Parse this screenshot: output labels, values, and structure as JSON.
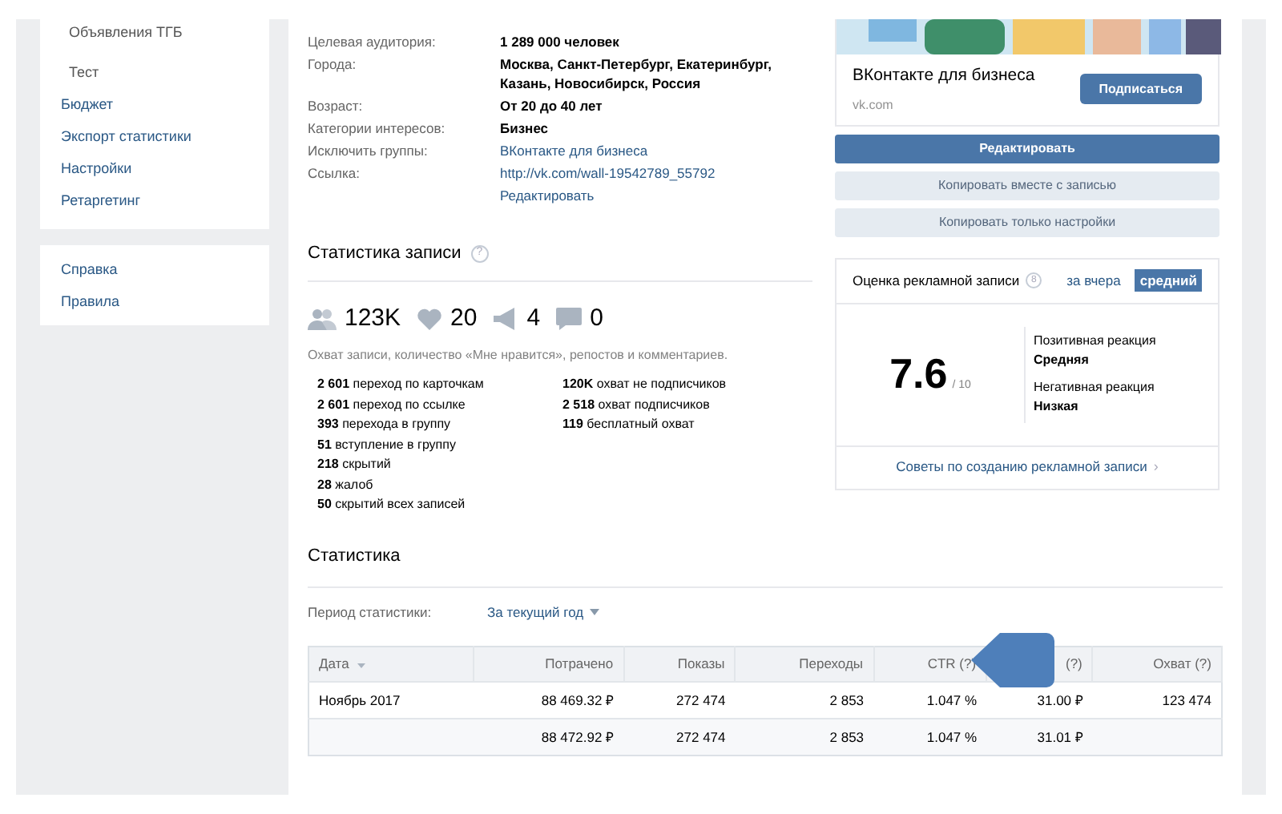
{
  "sidebar": {
    "items": [
      {
        "label": "Объявления ТГБ",
        "kind": "sub"
      },
      {
        "label": "Тест",
        "kind": "sub"
      },
      {
        "label": "Бюджет",
        "kind": "main"
      },
      {
        "label": "Экспорт статистики",
        "kind": "main"
      },
      {
        "label": "Настройки",
        "kind": "main"
      },
      {
        "label": "Ретаргетинг",
        "kind": "main"
      }
    ],
    "help_items": [
      "Справка",
      "Правила"
    ]
  },
  "ad_info": [
    {
      "label": "Целевая аудитория:",
      "value": "1 289 000 человек",
      "kind": "bold"
    },
    {
      "label": "Города:",
      "value": "Москва, Санкт-Петербург, Екатеринбург, Казань, Новосибирск, Россия",
      "kind": "bold"
    },
    {
      "label": "Возраст:",
      "value": "От 20 до 40 лет",
      "kind": "bold"
    },
    {
      "label": "Категории интересов:",
      "value": "Бизнес",
      "kind": "bold"
    },
    {
      "label": "Исключить группы:",
      "value": "ВКонтакте для бизнеса",
      "kind": "link"
    },
    {
      "label": "Ссылка:",
      "value": "http://vk.com/wall-19542789_55792",
      "kind": "link"
    },
    {
      "value": "Редактировать",
      "kind": "link"
    }
  ],
  "post_stats": {
    "title": "Статистика записи",
    "help": "?",
    "counters": [
      {
        "kind": "people",
        "value": "123K"
      },
      {
        "kind": "heart",
        "value": "20"
      },
      {
        "kind": "megaphone",
        "value": "4"
      },
      {
        "kind": "comment",
        "value": "0"
      }
    ],
    "caption": "Охват записи, количество «Мне нравится», репостов и комментариев.",
    "left_metrics": [
      "**2 601** переход по карточкам",
      "**2 601** переход по ссылке",
      "**393** перехода в группу",
      "**51** вступление в группу",
      "**218** скрытий",
      "**28** жалоб",
      "**50** скрытий всех записей"
    ],
    "right_metrics": [
      "**120K** охват не подписчиков",
      "**2 518** охват подписчиков",
      "**119** бесплатный охват"
    ]
  },
  "promo_card": {
    "kind": "picture",
    "title": "ВКонтакте для бизнеса",
    "domain": "vk.com",
    "button": "Подписаться"
  },
  "actions": [
    {
      "label": "Редактировать",
      "kind": "primary"
    },
    {
      "label": "Копировать вместе с записью",
      "kind": "secondary"
    },
    {
      "label": "Копировать только настройки",
      "kind": "secondary"
    }
  ],
  "rating": {
    "title": "Оценка рекламной записи",
    "help": "8",
    "tabs": [
      {
        "label": "за вчера",
        "selected": false
      },
      {
        "label": "средний",
        "selected": true
      }
    ],
    "score": "7.6",
    "scale": "/ 10",
    "positive_label": "Позитивная реакция",
    "positive_value": "Средняя",
    "negative_label": "Негативная реакция",
    "negative_value": "Низкая",
    "tips_link": "Советы по созданию рекламной записи",
    "tips_arrow": "›"
  },
  "statistics": {
    "title": "Статистика",
    "period_label": "Период статистики:",
    "period_value": "За текущий год",
    "columns": [
      "Дата",
      "Потрачено",
      "Показы",
      "Переходы",
      "CTR (?)",
      "(?)",
      "Охват (?)"
    ],
    "rows": [
      {
        "kind": "data",
        "cells": [
          "Ноябрь 2017",
          "88 469.32 ₽",
          "272 474",
          "2 853",
          "1.047 %",
          "31.00 ₽",
          "123 474"
        ]
      },
      {
        "kind": "total",
        "cells": [
          "",
          "88 472.92 ₽",
          "272 474",
          "2 853",
          "1.047 %",
          "31.01 ₽",
          ""
        ]
      }
    ]
  }
}
